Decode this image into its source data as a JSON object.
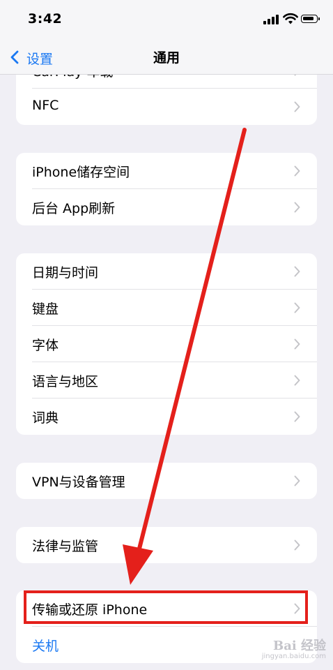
{
  "status_bar": {
    "time": "3:42"
  },
  "nav": {
    "back_label": "设置",
    "title": "通用"
  },
  "groups": [
    {
      "rows": [
        {
          "label": "CarPlay 车载"
        },
        {
          "label": "NFC"
        }
      ]
    },
    {
      "rows": [
        {
          "label": "iPhone储存空间"
        },
        {
          "label": "后台 App刷新"
        }
      ]
    },
    {
      "rows": [
        {
          "label": "日期与时间"
        },
        {
          "label": "键盘"
        },
        {
          "label": "字体"
        },
        {
          "label": "语言与地区"
        },
        {
          "label": "词典"
        }
      ]
    },
    {
      "rows": [
        {
          "label": "VPN与设备管理"
        }
      ]
    },
    {
      "rows": [
        {
          "label": "法律与监管"
        }
      ]
    },
    {
      "rows": [
        {
          "label": "传输或还原 iPhone"
        },
        {
          "label": "关机"
        }
      ]
    }
  ],
  "annotation": {
    "color": "#e4201b",
    "highlighted_row": "传输或还原 iPhone"
  },
  "watermark": {
    "logo": "Bai 经验",
    "sub": "jingyan.baidu.com"
  },
  "colors": {
    "accent": "#1a78f2",
    "background": "#f0eff5",
    "annotation": "#e4201b"
  }
}
